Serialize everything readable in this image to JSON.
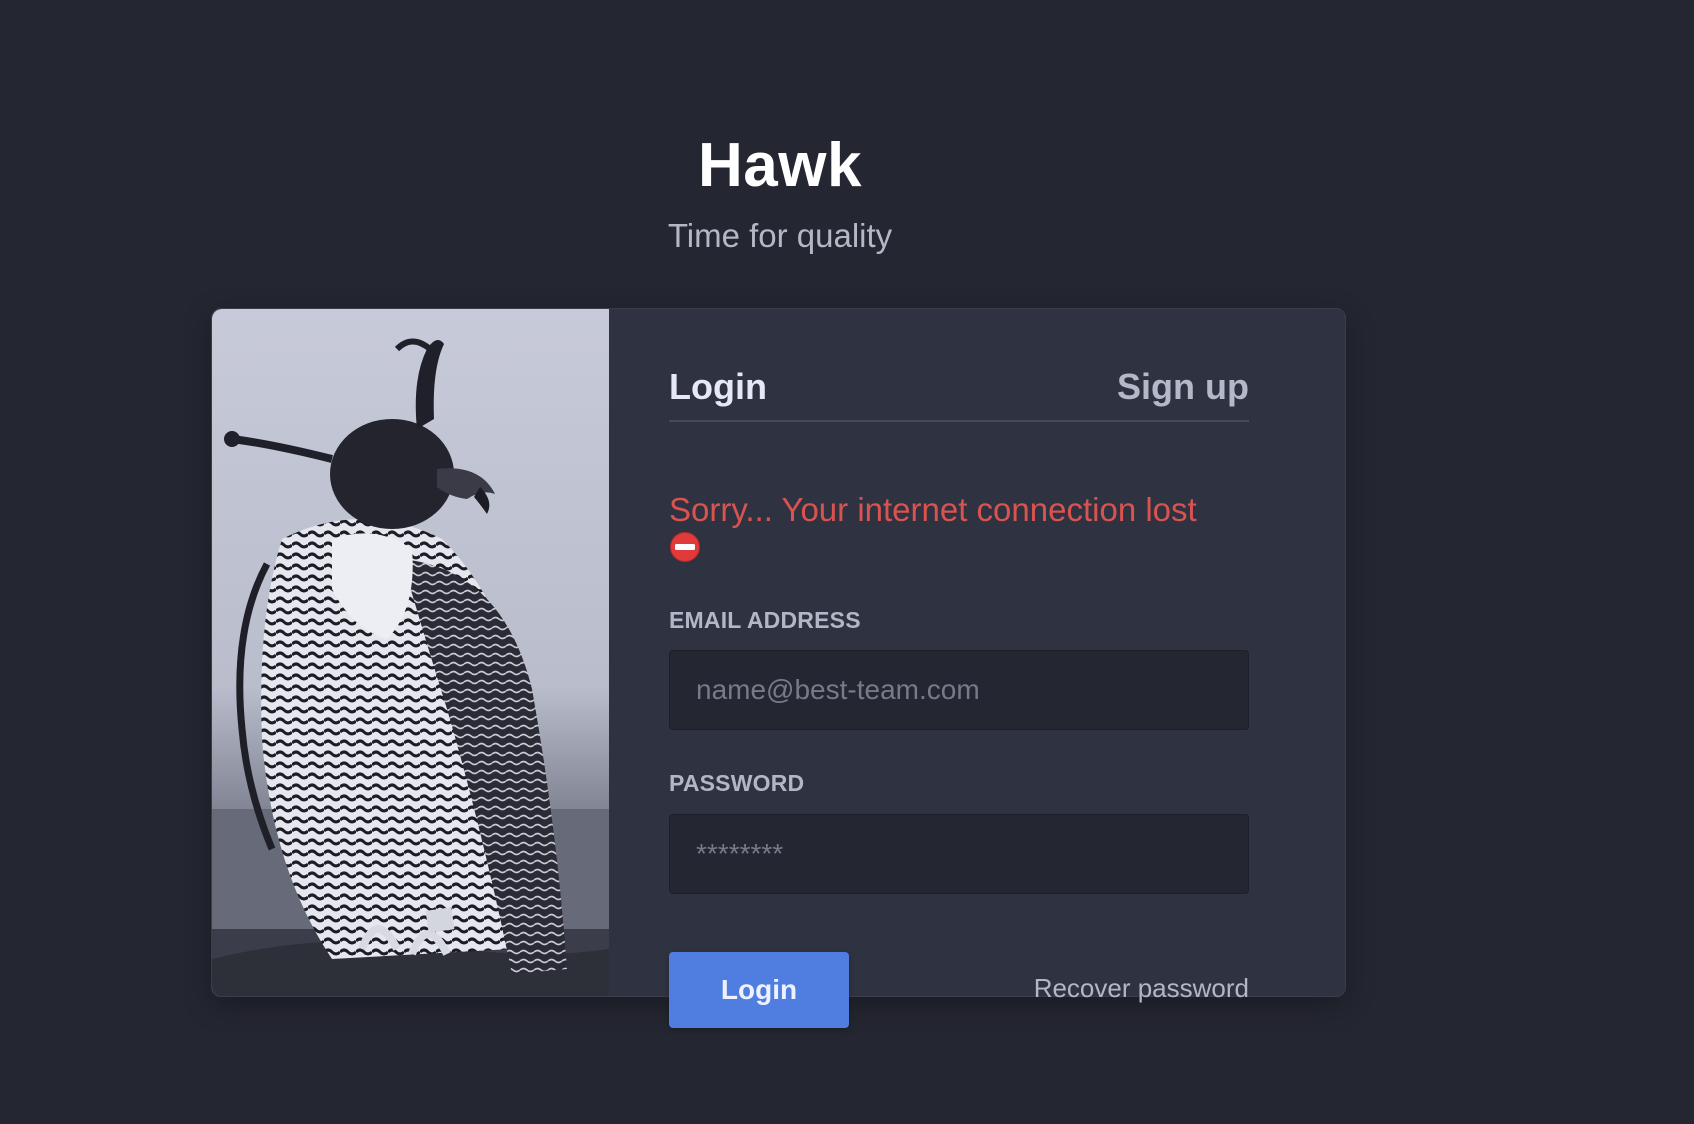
{
  "brand": {
    "title": "Hawk",
    "subtitle": "Time for quality"
  },
  "tabs": [
    {
      "label": "Login",
      "active": true
    },
    {
      "label": "Sign up",
      "active": false
    }
  ],
  "error": {
    "message": "Sorry... Your internet connection lost",
    "icon": "no-entry-icon",
    "color": "#d9534f"
  },
  "form": {
    "email": {
      "label": "EMAIL ADDRESS",
      "placeholder": "name@best-team.com",
      "value": ""
    },
    "password": {
      "label": "PASSWORD",
      "placeholder": "********",
      "value": ""
    },
    "submit_label": "Login",
    "recover_label": "Recover password"
  },
  "colors": {
    "background": "#242631",
    "card": "#2f3241",
    "accent": "#4f7de0",
    "error": "#d9534f"
  },
  "image": {
    "icon": "hooded-falcon-image"
  }
}
